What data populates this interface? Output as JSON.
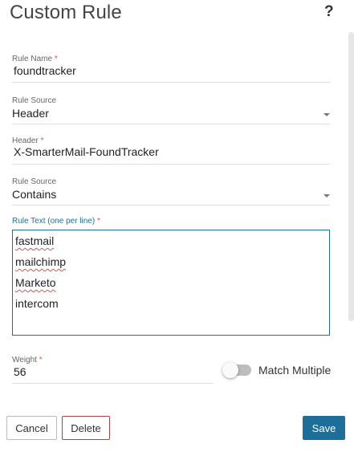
{
  "dialog": {
    "title": "Custom Rule",
    "help_label": "?"
  },
  "fields": {
    "rule_name": {
      "label": "Rule Name",
      "required_mark": "*",
      "value": "foundtracker"
    },
    "rule_source_1": {
      "label": "Rule Source",
      "value": "Header"
    },
    "header": {
      "label": "Header",
      "required_mark": "*",
      "value": "X-SmarterMail-FoundTracker"
    },
    "rule_source_2": {
      "label": "Rule Source",
      "value": "Contains"
    },
    "rule_text": {
      "label": "Rule Text (one per line)",
      "required_mark": "*",
      "lines": [
        "fastmail",
        "mailchimp",
        "Marketo",
        "intercom"
      ]
    },
    "weight": {
      "label": "Weight",
      "required_mark": "*",
      "value": "56"
    },
    "match_multiple": {
      "label": "Match Multiple",
      "enabled": false
    }
  },
  "buttons": {
    "cancel": "Cancel",
    "delete": "Delete",
    "save": "Save"
  },
  "colors": {
    "accent": "#1d6f99",
    "required": "#d9534f",
    "delete_border": "#a94442"
  }
}
